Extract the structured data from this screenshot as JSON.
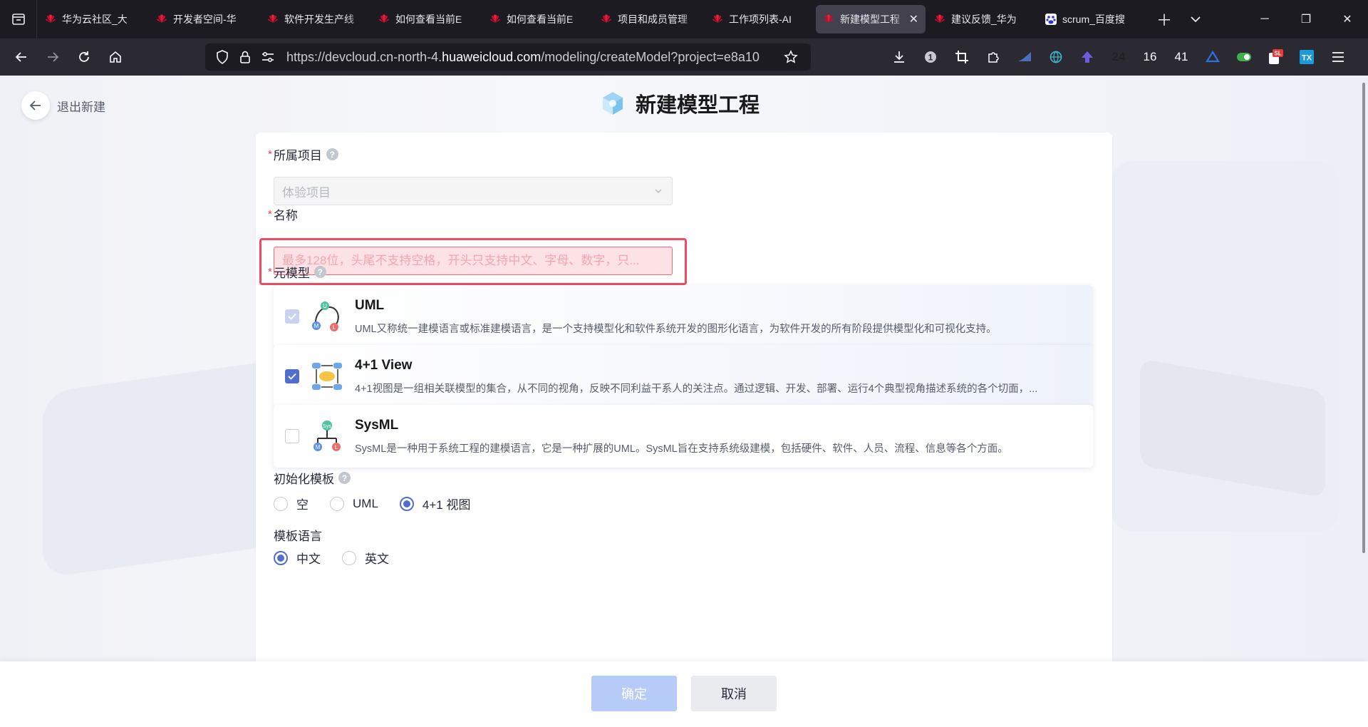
{
  "browser": {
    "tabs": [
      {
        "title": "华为云社区_大"
      },
      {
        "title": "开发者空间-华"
      },
      {
        "title": "软件开发生产线"
      },
      {
        "title": "如何查看当前E"
      },
      {
        "title": "如何查看当前E"
      },
      {
        "title": "项目和成员管理"
      },
      {
        "title": "工作项列表-AI"
      },
      {
        "title": "新建模型工程",
        "active": true
      },
      {
        "title": "建议反馈_华为"
      },
      {
        "title": "scrum_百度搜"
      }
    ],
    "url_prefix": "https://devcloud.cn-north-4.",
    "url_domain": "huaweicloud.com",
    "url_suffix": "/modeling/createModel?project=e8a10",
    "ext_counts": [
      "24",
      "16",
      "41"
    ],
    "ext_badges": [
      "SL",
      "TX"
    ]
  },
  "header": {
    "exit_label": "退出新建",
    "title": "新建模型工程"
  },
  "form": {
    "project": {
      "label": "所属项目",
      "value": "体验项目"
    },
    "name": {
      "label": "名称",
      "placeholder": "最多128位，头尾不支持空格，开头只支持中文、字母、数字，只..."
    },
    "metamodel": {
      "label": "元模型",
      "options": [
        {
          "title": "UML",
          "desc": "UML又称统一建模语言或标准建模语言，是一个支持模型化和软件系统开发的图形化语言，为软件开发的所有阶段提供模型化和可视化支持。"
        },
        {
          "title": "4+1 View",
          "desc": "4+1视图是一组相关联模型的集合，从不同的视角，反映不同利益干系人的关注点。通过逻辑、开发、部署、运行4个典型视角描述系统的各个切面，..."
        },
        {
          "title": "SysML",
          "desc": "SysML是一种用于系统工程的建模语言，它是一种扩展的UML。SysML旨在支持系统级建模，包括硬件、软件、人员、流程、信息等各个方面。"
        }
      ]
    },
    "template": {
      "label": "初始化模板",
      "options": [
        "空",
        "UML",
        "4+1 视图"
      ]
    },
    "language": {
      "label": "模板语言",
      "options": [
        "中文",
        "英文"
      ]
    }
  },
  "footer": {
    "ok": "确定",
    "cancel": "取消"
  },
  "colors": {
    "accent": "#526ecc",
    "error_border": "#ef4b61",
    "ok_disabled": "#b6cbf8"
  }
}
